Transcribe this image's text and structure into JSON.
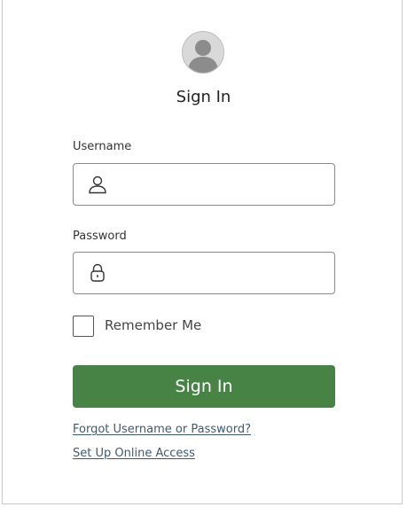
{
  "header": {
    "avatar_icon": "user-avatar-icon",
    "title": "Sign In"
  },
  "form": {
    "username": {
      "label": "Username",
      "value": "",
      "placeholder": "",
      "icon": "user-icon"
    },
    "password": {
      "label": "Password",
      "value": "",
      "placeholder": "",
      "icon": "lock-icon"
    },
    "remember_me": {
      "label": "Remember Me",
      "checked": false
    },
    "submit_label": "Sign In"
  },
  "links": {
    "forgot": "Forgot Username or Password?",
    "setup": "Set Up Online Access"
  },
  "colors": {
    "button_green": "#468345",
    "link_blue": "#3e5a72",
    "avatar_gray": "#d9d9d9"
  }
}
